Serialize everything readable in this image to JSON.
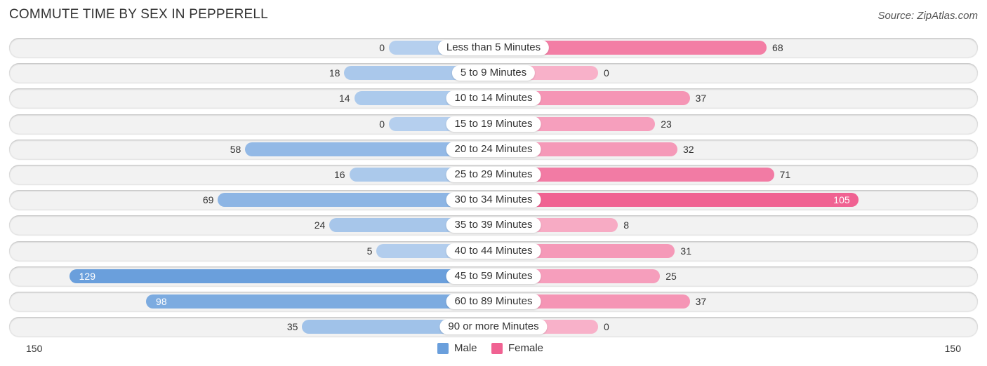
{
  "chart_data": {
    "type": "bar",
    "orientation": "horizontal-diverging",
    "title": "COMMUTE TIME BY SEX IN PEPPERELL",
    "source": "Source: ZipAtlas.com",
    "categories": [
      "Less than 5 Minutes",
      "5 to 9 Minutes",
      "10 to 14 Minutes",
      "15 to 19 Minutes",
      "20 to 24 Minutes",
      "25 to 29 Minutes",
      "30 to 34 Minutes",
      "35 to 39 Minutes",
      "40 to 44 Minutes",
      "45 to 59 Minutes",
      "60 to 89 Minutes",
      "90 or more Minutes"
    ],
    "series": [
      {
        "name": "Male",
        "color": "#6a9fdc",
        "values": [
          0,
          18,
          14,
          0,
          58,
          16,
          69,
          24,
          5,
          129,
          98,
          35
        ]
      },
      {
        "name": "Female",
        "color": "#f06292",
        "values": [
          68,
          0,
          37,
          23,
          32,
          71,
          105,
          8,
          31,
          25,
          37,
          0
        ]
      }
    ],
    "axis": {
      "left_label": "150",
      "right_label": "150",
      "range": [
        -150,
        150
      ]
    },
    "legend": {
      "position": "bottom-center",
      "entries": [
        "Male",
        "Female"
      ]
    },
    "grid": false
  }
}
